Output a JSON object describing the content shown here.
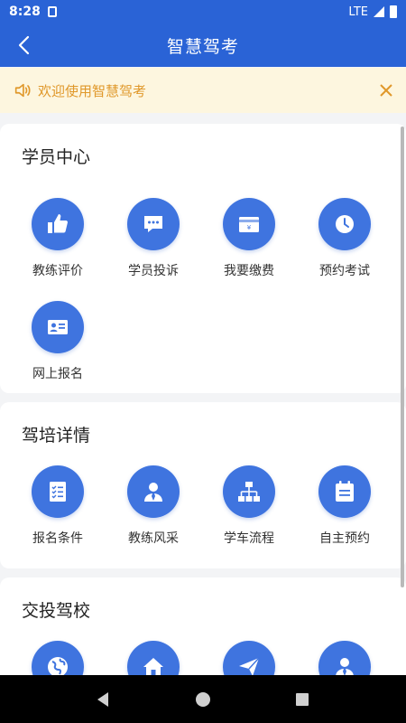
{
  "status": {
    "time": "8:28",
    "network": "LTE"
  },
  "header": {
    "title": "智慧驾考"
  },
  "notice": {
    "text": "欢迎使用智慧驾考"
  },
  "sections": [
    {
      "title": "学员中心",
      "items": [
        {
          "label": "教练评价",
          "icon": "thumbs-up-icon"
        },
        {
          "label": "学员投诉",
          "icon": "chat-bubble-icon"
        },
        {
          "label": "我要缴费",
          "icon": "payment-card-icon"
        },
        {
          "label": "预约考试",
          "icon": "clock-icon"
        },
        {
          "label": "网上报名",
          "icon": "id-card-icon"
        }
      ]
    },
    {
      "title": "驾培详情",
      "items": [
        {
          "label": "报名条件",
          "icon": "checklist-icon"
        },
        {
          "label": "教练风采",
          "icon": "person-tie-icon"
        },
        {
          "label": "学车流程",
          "icon": "flowchart-icon"
        },
        {
          "label": "自主预约",
          "icon": "calendar-note-icon"
        }
      ]
    },
    {
      "title": "交投驾校",
      "items": [
        {
          "label": "",
          "icon": "globe-icon"
        },
        {
          "label": "",
          "icon": "home-icon"
        },
        {
          "label": "",
          "icon": "paper-plane-icon"
        },
        {
          "label": "",
          "icon": "person-icon"
        }
      ]
    }
  ],
  "colors": {
    "primary": "#2a63d6",
    "icon_bg": "#3f74df",
    "notice_bg": "#fdf6df",
    "notice_text": "#e0982a"
  }
}
